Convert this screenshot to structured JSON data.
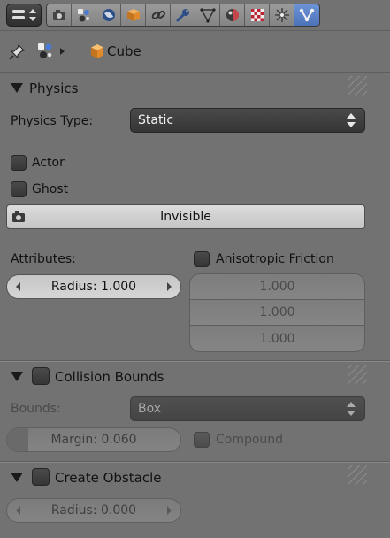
{
  "header": {
    "tabs": [
      {
        "icon": "render-camera-icon"
      },
      {
        "icon": "render-layers-icon"
      },
      {
        "icon": "world-icon"
      },
      {
        "icon": "object-cube-icon"
      },
      {
        "icon": "constraints-link-icon"
      },
      {
        "icon": "modifiers-wrench-icon"
      },
      {
        "icon": "object-data-mesh-icon"
      },
      {
        "icon": "material-sphere-icon"
      },
      {
        "icon": "texture-checker-icon"
      },
      {
        "icon": "particles-icon"
      },
      {
        "icon": "physics-icon",
        "active": true
      }
    ]
  },
  "breadcrumb": {
    "object_name": "Cube"
  },
  "physics_panel": {
    "title": "Physics",
    "physics_type_label": "Physics Type:",
    "physics_type_value": "Static",
    "actor_label": "Actor",
    "ghost_label": "Ghost",
    "invisible_label": "Invisible",
    "attributes_label": "Attributes:",
    "radius_value": "Radius: 1.000",
    "anisotropic_label": "Anisotropic Friction",
    "friction_values": [
      "1.000",
      "1.000",
      "1.000"
    ]
  },
  "collision_panel": {
    "title": "Collision Bounds",
    "bounds_label": "Bounds:",
    "bounds_value": "Box",
    "margin_value": "Margin: 0.060",
    "margin_fraction": 0.06,
    "compound_label": "Compound"
  },
  "obstacle_panel": {
    "title": "Create Obstacle",
    "radius_value": "Radius: 0.000"
  }
}
